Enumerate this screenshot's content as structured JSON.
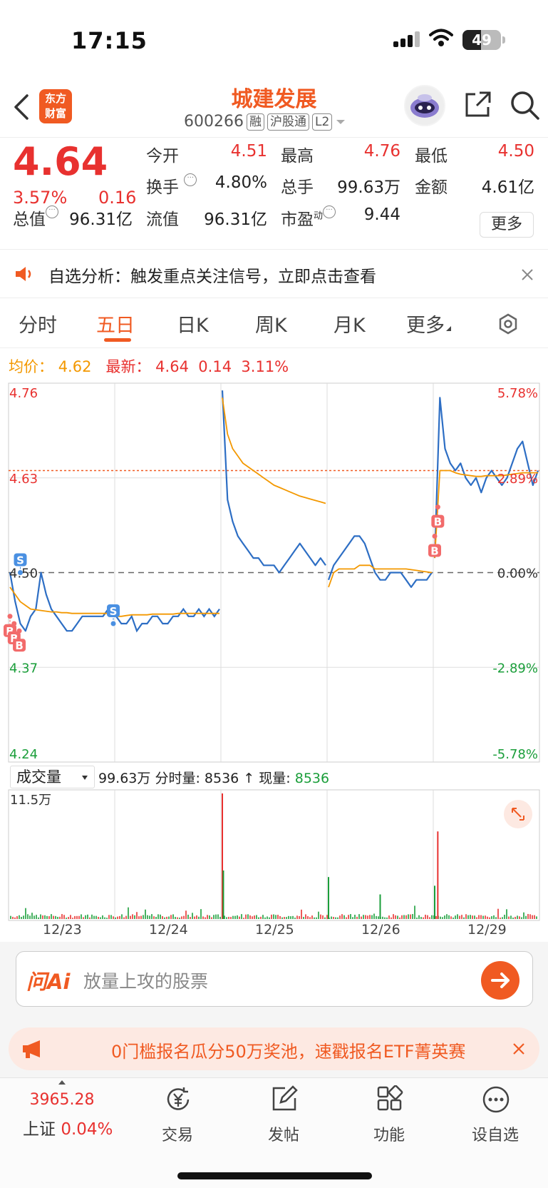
{
  "status": {
    "time": "17:15",
    "battery": "49"
  },
  "header": {
    "logo_line1": "东方",
    "logo_line2": "财富",
    "stock_name": "城建发展",
    "stock_code": "600266",
    "tags": [
      "融",
      "沪股通",
      "L2"
    ]
  },
  "quote": {
    "price": "4.64",
    "pct": "3.57%",
    "change": "0.16",
    "rows": [
      [
        {
          "label": "今开",
          "value": "4.51",
          "red": true
        },
        {
          "label": "最高",
          "value": "4.76",
          "red": true
        },
        {
          "label": "最低",
          "value": "4.50",
          "red": true
        }
      ],
      [
        {
          "label": "换手",
          "value": "4.80%",
          "red": false
        },
        {
          "label": "总手",
          "value": "99.63万",
          "red": false
        },
        {
          "label": "金额",
          "value": "4.61亿",
          "red": false
        }
      ],
      [
        {
          "label": "总值",
          "value": "96.31亿",
          "red": false
        },
        {
          "label": "流值",
          "value": "96.31亿",
          "red": false
        },
        {
          "label": "市盈",
          "value": "9.44",
          "red": false
        }
      ]
    ],
    "pe_sup": "动",
    "more_label": "更多"
  },
  "notice": {
    "text": "自选分析：触发重点关注信号，立即点击查看"
  },
  "tabs": {
    "items": [
      "分时",
      "五日",
      "日K",
      "周K",
      "月K",
      "更多"
    ],
    "active": 1
  },
  "avg_line": {
    "avg_label": "均价：",
    "avg_value": "4.62",
    "latest_label": "最新：",
    "latest_value": "4.64",
    "latest_change": "0.14",
    "latest_pct": "3.11%"
  },
  "chart_data": {
    "type": "line",
    "title": "",
    "x": [
      "12/23",
      "12/24",
      "12/25",
      "12/26",
      "12/29"
    ],
    "price_axis": {
      "ticks": [
        "4.76",
        "4.63",
        "4.50",
        "4.37",
        "4.24"
      ],
      "ylim": [
        4.24,
        4.76
      ],
      "prev_close": 4.5
    },
    "pct_axis": {
      "ticks": [
        "5.78%",
        "2.89%",
        "0.00%",
        "-2.89%",
        "-5.78%"
      ]
    },
    "latest_price_line": 4.64,
    "series": [
      {
        "name": "",
        "color": "#2d6ec4",
        "days": [
          [
            4.5,
            4.46,
            4.43,
            4.42,
            4.44,
            4.45,
            4.5,
            4.47,
            4.45,
            4.44,
            4.43,
            4.42,
            4.42,
            4.43,
            4.44,
            4.44,
            4.44,
            4.44,
            4.44,
            4.45,
            4.45
          ],
          [
            4.75,
            4.6,
            4.57,
            4.55,
            4.54,
            4.53,
            4.52,
            4.52,
            4.51,
            4.51,
            4.51,
            4.5,
            4.51,
            4.52,
            4.53,
            4.54,
            4.53,
            4.52,
            4.51,
            4.52,
            4.51
          ],
          [
            4.49,
            4.51,
            4.52,
            4.53,
            4.54,
            4.55,
            4.55,
            4.54,
            4.52,
            4.5,
            4.49,
            4.49,
            4.5,
            4.5,
            4.5,
            4.49,
            4.48,
            4.49,
            4.49,
            4.49,
            4.5
          ],
          [
            4.52,
            4.74,
            4.67,
            4.65,
            4.64,
            4.65,
            4.63,
            4.62,
            4.63,
            4.61,
            4.63,
            4.64,
            4.63,
            4.62,
            4.63,
            4.65,
            4.67,
            4.68,
            4.65,
            4.62,
            4.64
          ]
        ]
      },
      {
        "name": "",
        "color": "#f39800",
        "days": [
          [
            4.48,
            4.47,
            4.46,
            4.455,
            4.45,
            4.449,
            4.448,
            4.447,
            4.446,
            4.446,
            4.445,
            4.445,
            4.444,
            4.444,
            4.444,
            4.444,
            4.444,
            4.444,
            4.444,
            4.444,
            4.444
          ],
          [
            4.74,
            4.69,
            4.67,
            4.66,
            4.65,
            4.645,
            4.64,
            4.635,
            4.63,
            4.625,
            4.62,
            4.617,
            4.614,
            4.611,
            4.608,
            4.605,
            4.603,
            4.601,
            4.599,
            4.597,
            4.595
          ],
          [
            4.48,
            4.5,
            4.505,
            4.505,
            4.505,
            4.505,
            4.51,
            4.51,
            4.51,
            4.505,
            4.505,
            4.505,
            4.505,
            4.505,
            4.505,
            4.505,
            4.504,
            4.503,
            4.502,
            4.501,
            4.5
          ],
          [
            4.52,
            4.64,
            4.64,
            4.64,
            4.637,
            4.635,
            4.634,
            4.633,
            4.632,
            4.632,
            4.633,
            4.633,
            4.633,
            4.633,
            4.634,
            4.635,
            4.636,
            4.637,
            4.637,
            4.637,
            4.637
          ]
        ]
      }
    ],
    "markers": [
      {
        "label": "S",
        "price": 4.5,
        "day": 0,
        "pos": 0.1
      },
      {
        "label": "S",
        "price": 4.43,
        "day": 0,
        "pos": 1.0
      },
      {
        "label": "B",
        "price": 4.44,
        "day": 0,
        "pos": 0.0
      },
      {
        "label": "B",
        "price": 4.43,
        "day": 0,
        "pos": 0.04
      },
      {
        "label": "B",
        "price": 4.42,
        "day": 0,
        "pos": 0.09
      },
      {
        "label": "B",
        "price": 4.55,
        "day": 3,
        "pos": 0.0
      },
      {
        "label": "B",
        "price": 4.59,
        "day": 3,
        "pos": 0.03
      }
    ]
  },
  "volume": {
    "selector": "成交量",
    "total": "99.63万",
    "fen_label": "分时量:",
    "fen_value": "8536",
    "now_label": "现量:",
    "now_value": "8536",
    "max_label": "11.5万",
    "spikes": [
      {
        "day": 1,
        "pos": 0.0,
        "value": 11.5
      },
      {
        "day": 3,
        "pos": 0.03,
        "value": 8.0
      },
      {
        "day": 1,
        "pos": 0.01,
        "value": 4.4
      },
      {
        "day": 2,
        "pos": 0.0,
        "value": 3.8
      },
      {
        "day": 2,
        "pos": 0.5,
        "value": 2.2
      },
      {
        "day": 3,
        "pos": 0.0,
        "value": 3.0
      }
    ]
  },
  "ai": {
    "logo": "问Ai",
    "placeholder": "放量上攻的股票"
  },
  "promo": {
    "text": "0门槛报名瓜分50万奖池，速戳报名ETF菁英赛"
  },
  "bottom_nav": {
    "index_value": "3965.28",
    "index_name": "上证",
    "index_pct": "0.04%",
    "items": [
      "交易",
      "发帖",
      "功能",
      "设自选"
    ]
  }
}
